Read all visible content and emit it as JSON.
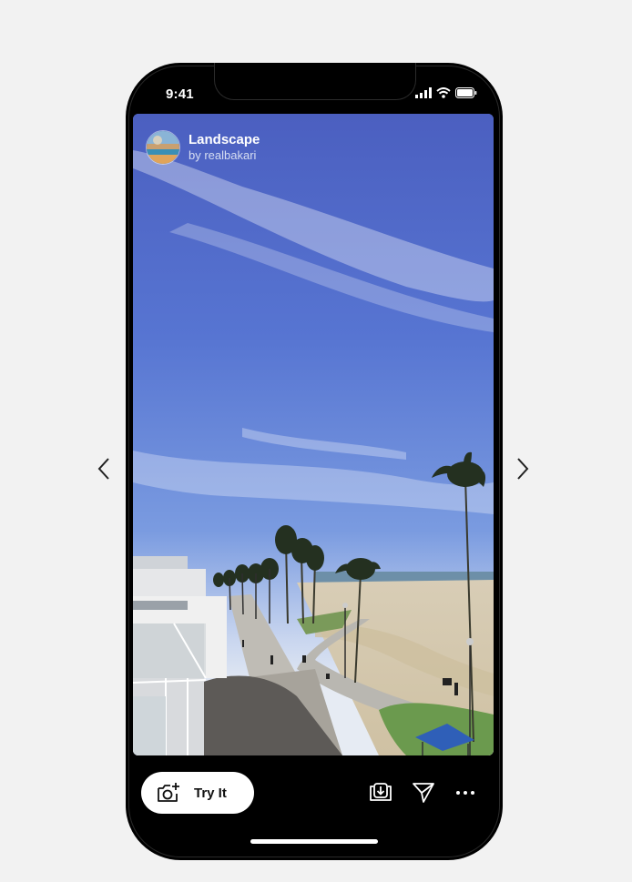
{
  "status_bar": {
    "time": "9:41"
  },
  "story": {
    "effect_title": "Landscape",
    "effect_author": "by realbakari"
  },
  "actions": {
    "try_label": "Try It"
  },
  "icons": {
    "prev": "chevron-left-icon",
    "next": "chevron-right-icon",
    "camera": "camera-plus-icon",
    "save": "save-download-icon",
    "share": "send-icon",
    "more": "more-horizontal-icon"
  },
  "colors": {
    "page_background": "#f2f2f2",
    "phone_frame": "#000000",
    "button_background": "#ffffff",
    "sky": "#5f7fd6"
  }
}
